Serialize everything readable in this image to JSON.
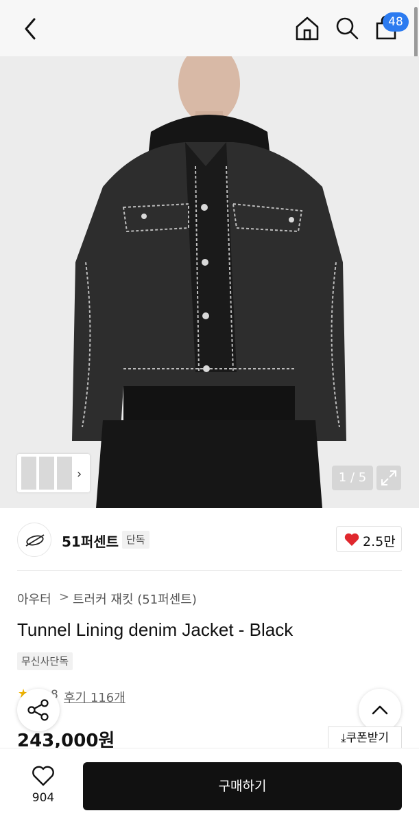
{
  "header": {
    "back_icon": "chevron-left-icon",
    "home_icon": "home-icon",
    "search_icon": "search-icon",
    "cart_icon": "shopping-bag-icon",
    "cart_count": "48",
    "badge_color": "#2c7bf0"
  },
  "gallery": {
    "counter": "1 / 5",
    "expand_icon": "expand-icon",
    "thumb_arrow": "›"
  },
  "brand": {
    "name": "51퍼센트",
    "badge": "단독",
    "like_count": "2.5만",
    "like_color": "#e0282e"
  },
  "breadcrumb": {
    "category": "아우터",
    "separator": ">",
    "subcategory": "트러커 재킷 (51퍼센트)"
  },
  "product": {
    "title": "Tunnel Lining denim Jacket - Black",
    "exclusive_tag": "무신사단독",
    "rating_score": "8",
    "review_text": "후기 116개",
    "price": "243,000원",
    "coupon_label": "쿠폰받기"
  },
  "bottom": {
    "wish_count": "904",
    "buy_label": "구매하기"
  }
}
